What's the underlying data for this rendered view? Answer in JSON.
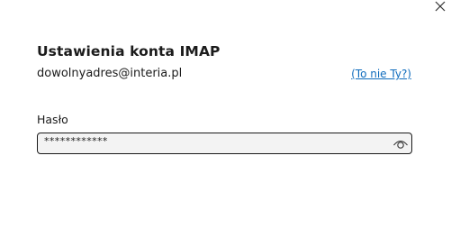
{
  "dialog": {
    "title": "Ustawienia konta IMAP",
    "email": "dowolnyadres@interia.pl",
    "not_you_link": "(To nie Ty?)",
    "password_label": "Hasło",
    "password_value": "************"
  },
  "icons": {
    "close": "close-icon",
    "show_password": "eye-icon"
  },
  "colors": {
    "link": "#0f6cbd",
    "field_background": "#f3f3f3",
    "field_border": "#1a1a1a"
  }
}
